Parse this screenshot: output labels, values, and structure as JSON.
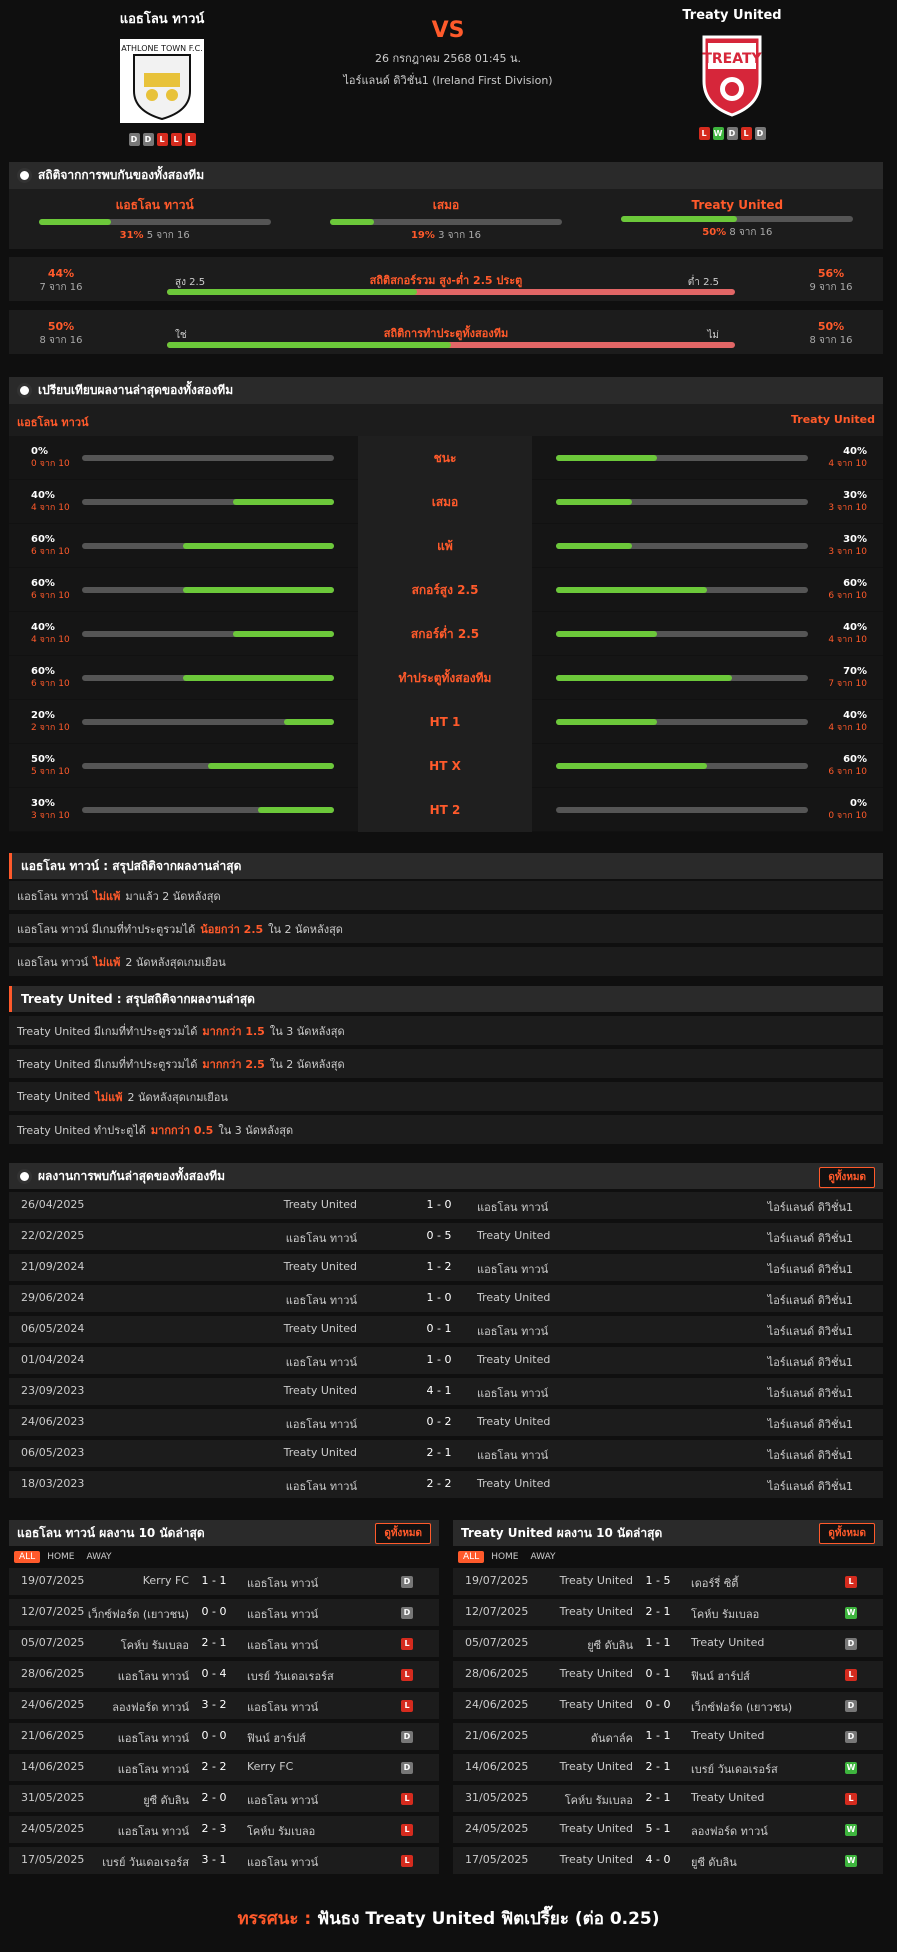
{
  "header": {
    "home": "แอธโลน ทาวน์",
    "away": "Treaty United",
    "vs": "VS",
    "date": "26 กรกฎาคม 2568 01:45 น.",
    "league": "ไอร์แลนด์ ดิวิชั่น1 (Ireland First Division)",
    "home_form": [
      "D",
      "D",
      "L",
      "L",
      "L"
    ],
    "away_form": [
      "L",
      "W",
      "D",
      "L",
      "D"
    ],
    "home_logo_text": "ATHLONE TOWN F.C.",
    "away_logo_text": "TREATY"
  },
  "h2h": {
    "title": "สถิติจากการพบกันของทั้งสองทีม",
    "cols": [
      {
        "label": "แอธโลน ทาวน์",
        "pct": "31%",
        "sub": "5 จาก 16",
        "v": 31
      },
      {
        "label": "เสมอ",
        "pct": "19%",
        "sub": "3 จาก 16",
        "v": 19
      },
      {
        "label": "Treaty United",
        "pct": "50%",
        "sub": "8 จาก 16",
        "v": 50
      }
    ]
  },
  "ou": {
    "left_pct": "44%",
    "left_sub": "7 จาก 16",
    "left_label": "สูง 2.5",
    "title": "สถิติสกอร์รวม สูง-ต่ำ 2.5 ประตู",
    "right_label": "ต่ำ 2.5",
    "right_pct": "56%",
    "right_sub": "9 จาก 16",
    "v": 44
  },
  "btts": {
    "left_pct": "50%",
    "left_sub": "8 จาก 16",
    "left_label": "ใช่",
    "title": "สถิติการทำประตูทั้งสองทีม",
    "right_label": "ไม่",
    "right_pct": "50%",
    "right_sub": "8 จาก 16",
    "v": 50
  },
  "compare": {
    "title": "เปรียบเทียบผลงานล่าสุดของทั้งสองทีม",
    "home": "แอธโลน ทาวน์",
    "away": "Treaty United",
    "rows": [
      {
        "label": "ชนะ",
        "hp": "0%",
        "hs": "0 จาก 10",
        "hv": 0,
        "ap": "40%",
        "as": "4 จาก 10",
        "av": 40
      },
      {
        "label": "เสมอ",
        "hp": "40%",
        "hs": "4 จาก 10",
        "hv": 40,
        "ap": "30%",
        "as": "3 จาก 10",
        "av": 30
      },
      {
        "label": "แพ้",
        "hp": "60%",
        "hs": "6 จาก 10",
        "hv": 60,
        "ap": "30%",
        "as": "3 จาก 10",
        "av": 30
      },
      {
        "label": "สกอร์สูง 2.5",
        "hp": "60%",
        "hs": "6 จาก 10",
        "hv": 60,
        "ap": "60%",
        "as": "6 จาก 10",
        "av": 60
      },
      {
        "label": "สกอร์ต่ำ 2.5",
        "hp": "40%",
        "hs": "4 จาก 10",
        "hv": 40,
        "ap": "40%",
        "as": "4 จาก 10",
        "av": 40
      },
      {
        "label": "ทำประตูทั้งสองทีม",
        "hp": "60%",
        "hs": "6 จาก 10",
        "hv": 60,
        "ap": "70%",
        "as": "7 จาก 10",
        "av": 70
      },
      {
        "label": "HT 1",
        "hp": "20%",
        "hs": "2 จาก 10",
        "hv": 20,
        "ap": "40%",
        "as": "4 จาก 10",
        "av": 40
      },
      {
        "label": "HT X",
        "hp": "50%",
        "hs": "5 จาก 10",
        "hv": 50,
        "ap": "60%",
        "as": "6 จาก 10",
        "av": 60
      },
      {
        "label": "HT 2",
        "hp": "30%",
        "hs": "3 จาก 10",
        "hv": 30,
        "ap": "0%",
        "as": "0 จาก 10",
        "av": 0
      }
    ]
  },
  "home_summary": {
    "title": "แอธโลน ทาวน์ : สรุปสถิติจากผลงานล่าสุด",
    "rows": [
      [
        "แอธโลน ทาวน์",
        "ไม่แพ้",
        "มาแล้ว 2 นัดหลังสุด"
      ],
      [
        "แอธโลน ทาวน์ มีเกมที่ทำประตูรวมได้",
        "น้อยกว่า 2.5",
        "ใน 2 นัดหลังสุด"
      ],
      [
        "แอธโลน ทาวน์",
        "ไม่แพ้",
        "2 นัดหลังสุดเกมเยือน"
      ]
    ]
  },
  "away_summary": {
    "title": "Treaty United : สรุปสถิติจากผลงานล่าสุด",
    "rows": [
      [
        "Treaty United มีเกมที่ทำประตูรวมได้",
        "มากกว่า 1.5",
        "ใน 3 นัดหลังสุด"
      ],
      [
        "Treaty United มีเกมที่ทำประตูรวมได้",
        "มากกว่า 2.5",
        "ใน 2 นัดหลังสุด"
      ],
      [
        "Treaty United",
        "ไม่แพ้",
        "2 นัดหลังสุดเกมเยือน"
      ],
      [
        "Treaty United ทำประตูได้",
        "มากกว่า 0.5",
        "ใน 3 นัดหลังสุด"
      ]
    ]
  },
  "meetings": {
    "title": "ผลงานการพบกันล่าสุดของทั้งสองทีม",
    "view_all": "ดูทั้งหมด",
    "rows": [
      [
        "26/04/2025",
        "Treaty United",
        "1 - 0",
        "แอธโลน ทาวน์",
        "ไอร์แลนด์ ดิวิชั่น1"
      ],
      [
        "22/02/2025",
        "แอธโลน ทาวน์",
        "0 - 5",
        "Treaty United",
        "ไอร์แลนด์ ดิวิชั่น1"
      ],
      [
        "21/09/2024",
        "Treaty United",
        "1 - 2",
        "แอธโลน ทาวน์",
        "ไอร์แลนด์ ดิวิชั่น1"
      ],
      [
        "29/06/2024",
        "แอธโลน ทาวน์",
        "1 - 0",
        "Treaty United",
        "ไอร์แลนด์ ดิวิชั่น1"
      ],
      [
        "06/05/2024",
        "Treaty United",
        "0 - 1",
        "แอธโลน ทาวน์",
        "ไอร์แลนด์ ดิวิชั่น1"
      ],
      [
        "01/04/2024",
        "แอธโลน ทาวน์",
        "1 - 0",
        "Treaty United",
        "ไอร์แลนด์ ดิวิชั่น1"
      ],
      [
        "23/09/2023",
        "Treaty United",
        "4 - 1",
        "แอธโลน ทาวน์",
        "ไอร์แลนด์ ดิวิชั่น1"
      ],
      [
        "24/06/2023",
        "แอธโลน ทาวน์",
        "0 - 2",
        "Treaty United",
        "ไอร์แลนด์ ดิวิชั่น1"
      ],
      [
        "06/05/2023",
        "Treaty United",
        "2 - 1",
        "แอธโลน ทาวน์",
        "ไอร์แลนด์ ดิวิชั่น1"
      ],
      [
        "18/03/2023",
        "แอธโลน ทาวน์",
        "2 - 2",
        "Treaty United",
        "ไอร์แลนด์ ดิวิชั่น1"
      ]
    ]
  },
  "home_last": {
    "title": "แอธโลน ทาวน์ ผลงาน 10 นัดล่าสุด",
    "view_all": "ดูทั้งหมด",
    "tabs": [
      "ALL",
      "HOME",
      "AWAY"
    ],
    "rows": [
      [
        "19/07/2025",
        "Kerry FC",
        "1 - 1",
        "แอธโลน ทาวน์",
        "D"
      ],
      [
        "12/07/2025",
        "เว็กซ์ฟอร์ด (เยาวชน)",
        "0 - 0",
        "แอธโลน ทาวน์",
        "D"
      ],
      [
        "05/07/2025",
        "โคห์บ รัมเบลอ",
        "2 - 1",
        "แอธโลน ทาวน์",
        "L"
      ],
      [
        "28/06/2025",
        "แอธโลน ทาวน์",
        "0 - 4",
        "เบรย์ วันเดอเรอร์ส",
        "L"
      ],
      [
        "24/06/2025",
        "ลองฟอร์ด ทาวน์",
        "3 - 2",
        "แอธโลน ทาวน์",
        "L"
      ],
      [
        "21/06/2025",
        "แอธโลน ทาวน์",
        "0 - 0",
        "ฟินน์ ฮาร์ปส์",
        "D"
      ],
      [
        "14/06/2025",
        "แอธโลน ทาวน์",
        "2 - 2",
        "Kerry FC",
        "D"
      ],
      [
        "31/05/2025",
        "ยูซี ดับลิน",
        "2 - 0",
        "แอธโลน ทาวน์",
        "L"
      ],
      [
        "24/05/2025",
        "แอธโลน ทาวน์",
        "2 - 3",
        "โคห์บ รัมเบลอ",
        "L"
      ],
      [
        "17/05/2025",
        "เบรย์ วันเดอเรอร์ส",
        "3 - 1",
        "แอธโลน ทาวน์",
        "L"
      ]
    ]
  },
  "away_last": {
    "title": "Treaty United ผลงาน 10 นัดล่าสุด",
    "view_all": "ดูทั้งหมด",
    "tabs": [
      "ALL",
      "HOME",
      "AWAY"
    ],
    "rows": [
      [
        "19/07/2025",
        "Treaty United",
        "1 - 5",
        "เดอร์รี่ ซิตี้",
        "L"
      ],
      [
        "12/07/2025",
        "Treaty United",
        "2 - 1",
        "โคห์บ รัมเบลอ",
        "W"
      ],
      [
        "05/07/2025",
        "ยูซี ดับลิน",
        "1 - 1",
        "Treaty United",
        "D"
      ],
      [
        "28/06/2025",
        "Treaty United",
        "0 - 1",
        "ฟินน์ ฮาร์ปส์",
        "L"
      ],
      [
        "24/06/2025",
        "Treaty United",
        "0 - 0",
        "เว็กซ์ฟอร์ด (เยาวชน)",
        "D"
      ],
      [
        "21/06/2025",
        "ดันดาล์ค",
        "1 - 1",
        "Treaty United",
        "D"
      ],
      [
        "14/06/2025",
        "Treaty United",
        "2 - 1",
        "เบรย์ วันเดอเรอร์ส",
        "W"
      ],
      [
        "31/05/2025",
        "โคห์บ รัมเบลอ",
        "2 - 1",
        "Treaty United",
        "L"
      ],
      [
        "24/05/2025",
        "Treaty United",
        "5 - 1",
        "ลองฟอร์ด ทาวน์",
        "W"
      ],
      [
        "17/05/2025",
        "Treaty United",
        "4 - 0",
        "ยูซี ดับลิน",
        "W"
      ]
    ]
  },
  "verdict": {
    "label": "ทรรศนะ :",
    "text": "ฟันธง Treaty United ฟิตเปรี๊ยะ (ต่อ 0.25)"
  }
}
